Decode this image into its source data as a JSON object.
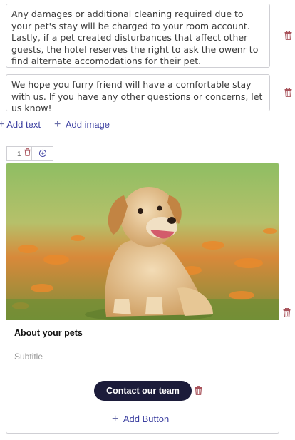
{
  "blocks": [
    {
      "text": "Any damages or additional cleaning required due to your pet's stay will be charged to your room account. Lastly, if a pet created disturbances that affect other guests, the hotel reserves the right to ask the owenr to find alternate accomodations for their pet."
    },
    {
      "text": "We hope you furry friend will have a comfortable stay with us. If you have any other questions or concerns, let us know!"
    }
  ],
  "add_text": "Add text",
  "add_image": "Add image",
  "pager": {
    "page": "1"
  },
  "card": {
    "title": "About your pets",
    "subtitle": "Subtitle",
    "cta": "Contact our team",
    "add_button": "Add Button"
  },
  "colors": {
    "accent": "#3b3fa0",
    "cta_bg": "#1c1c3a",
    "trash": "#a8525a"
  },
  "icons": [
    "trash-icon",
    "plus-icon",
    "add-circle-icon"
  ]
}
